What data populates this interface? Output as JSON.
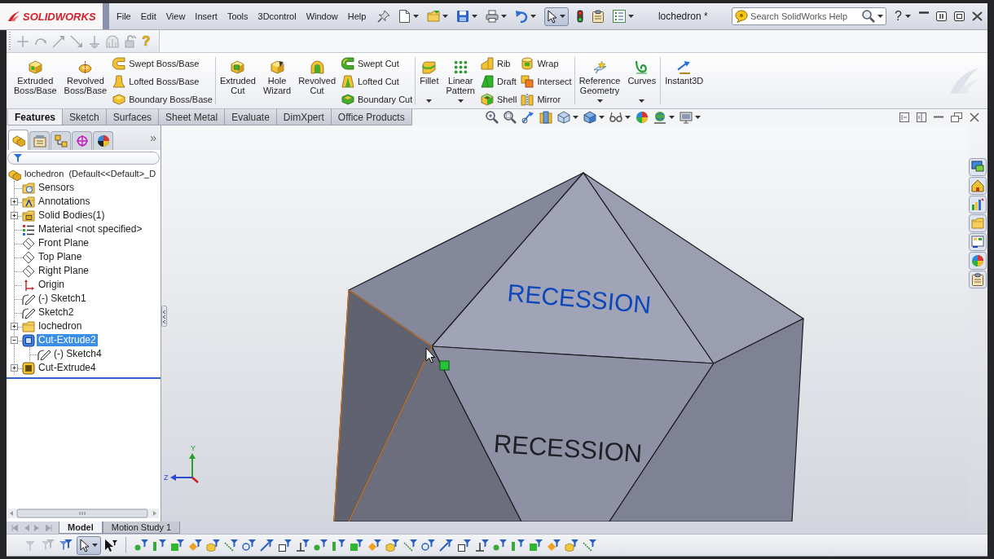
{
  "title_bar": {
    "logo": "SOLIDWORKS",
    "menu": [
      "File",
      "Edit",
      "View",
      "Insert",
      "Tools",
      "3Dcontrol",
      "Window",
      "Help"
    ],
    "select_pressed": true,
    "document_title": "lochedron *",
    "search": {
      "placeholder": "Search SolidWorks Help"
    },
    "help_glyph": "?"
  },
  "sketch_toolbar": {
    "help_glyph": "?"
  },
  "command_manager": {
    "groups": [
      {
        "blocks": [
          {
            "kind": "large",
            "label": "Extruded Boss/Base",
            "dropdown": false
          },
          {
            "kind": "large",
            "label": "Revolved Boss/Base",
            "dropdown": false
          },
          {
            "kind": "stack",
            "items": [
              "Swept Boss/Base",
              "Lofted Boss/Base",
              "Boundary Boss/Base"
            ]
          }
        ]
      },
      {
        "blocks": [
          {
            "kind": "large",
            "label": "Extruded Cut",
            "dropdown": false
          },
          {
            "kind": "large",
            "label": "Hole Wizard",
            "dropdown": false
          },
          {
            "kind": "large",
            "label": "Revolved Cut",
            "dropdown": false
          },
          {
            "kind": "stack",
            "items": [
              "Swept Cut",
              "Lofted Cut",
              "Boundary Cut"
            ]
          }
        ]
      },
      {
        "blocks": [
          {
            "kind": "large",
            "label": "Fillet",
            "dropdown": true
          },
          {
            "kind": "large",
            "label": "Linear Pattern",
            "dropdown": true
          },
          {
            "kind": "stack",
            "items": [
              "Rib",
              "Draft",
              "Shell"
            ]
          },
          {
            "kind": "stack",
            "items": [
              "Wrap",
              "Intersect",
              "Mirror"
            ]
          }
        ]
      },
      {
        "blocks": [
          {
            "kind": "large",
            "label": "Reference Geometry",
            "dropdown": true
          },
          {
            "kind": "large",
            "label": "Curves",
            "dropdown": true
          }
        ]
      },
      {
        "blocks": [
          {
            "kind": "large",
            "label": "Instant3D",
            "dropdown": false
          }
        ]
      }
    ],
    "tabs": [
      {
        "label": "Features",
        "selected": true
      },
      {
        "label": "Sketch",
        "selected": false
      },
      {
        "label": "Surfaces",
        "selected": false
      },
      {
        "label": "Sheet Metal",
        "selected": false
      },
      {
        "label": "Evaluate",
        "selected": false
      },
      {
        "label": "DimXpert",
        "selected": false
      },
      {
        "label": "Office Products",
        "selected": false
      }
    ]
  },
  "feature_manager": {
    "panel_tabs": [
      {
        "selected": true
      },
      {
        "selected": false
      },
      {
        "selected": false
      },
      {
        "selected": false
      },
      {
        "selected": false
      }
    ],
    "more_glyph": "»",
    "tree": {
      "label": "lochedron  (Default<<Default>_D",
      "kind": "part",
      "selected": false,
      "children": [
        {
          "label": "Sensors",
          "kind": "sensors",
          "selected": false
        },
        {
          "label": "Annotations",
          "kind": "annotations",
          "selected": false,
          "expanded": false
        },
        {
          "label": "Solid Bodies(1)",
          "kind": "bodies",
          "selected": false,
          "expanded": false
        },
        {
          "label": "Material <not specified>",
          "kind": "material",
          "selected": false
        },
        {
          "label": "Front Plane",
          "kind": "plane",
          "selected": false
        },
        {
          "label": "Top Plane",
          "kind": "plane",
          "selected": false
        },
        {
          "label": "Right Plane",
          "kind": "plane",
          "selected": false
        },
        {
          "label": "Origin",
          "kind": "origin",
          "selected": false
        },
        {
          "label": "(-) Sketch1",
          "kind": "sketch",
          "selected": false
        },
        {
          "label": "Sketch2",
          "kind": "sketch",
          "selected": false
        },
        {
          "label": "Iochedron",
          "kind": "folder",
          "selected": false,
          "expanded": false
        },
        {
          "label": "Cut-Extrude2",
          "kind": "cut",
          "selected": true,
          "expanded": true,
          "children": [
            {
              "label": "(-) Sketch4",
              "kind": "sketch",
              "selected": false
            }
          ]
        },
        {
          "label": "Cut-Extrude4",
          "kind": "cut",
          "selected": false,
          "expanded": false
        }
      ]
    }
  },
  "viewport": {
    "model_text": [
      {
        "text": "RECESSION",
        "highlighted": true
      },
      {
        "text": "RECESSION",
        "highlighted": false
      }
    ],
    "axis_labels": [
      "Y",
      "Z"
    ]
  },
  "bottom_tabs": [
    {
      "label": "Model",
      "selected": true
    },
    {
      "label": "Motion Study 1",
      "selected": false
    }
  ],
  "selection_filter_bar": {
    "select_pressed": true
  }
}
